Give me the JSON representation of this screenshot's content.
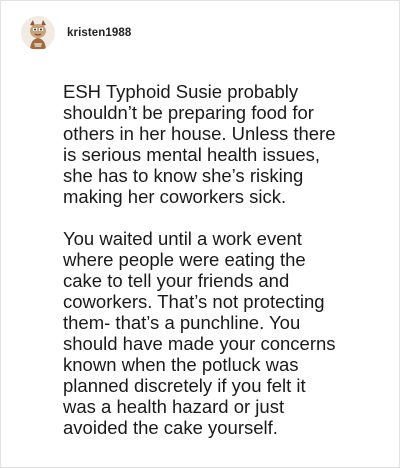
{
  "post": {
    "username": "kristen1988",
    "avatar_icon": "cartoon-avatar-icon",
    "paragraphs": [
      "ESH Typhoid Susie probably\nshouldn’t be preparing food for\nothers in her house. Unless there\nis serious mental health issues,\nshe has to know she’s risking\nmaking her coworkers sick.",
      "You waited until a work event\nwhere people were eating the\ncake to tell your friends and\ncoworkers. That’s not protecting\nthem- that’s a punchline. You\nshould have made your concerns\nknown when the potluck was\nplanned discretely if you felt it\nwas a health hazard or just\navoided the cake yourself."
    ]
  },
  "colors": {
    "text": "#1a1a1a",
    "username": "#222222",
    "border": "#e2e2e2"
  }
}
